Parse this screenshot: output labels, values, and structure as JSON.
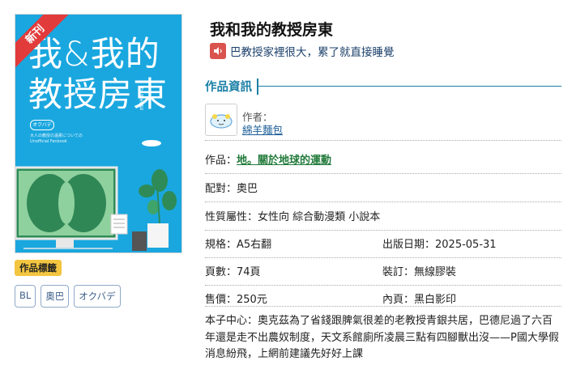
{
  "cover": {
    "badge": "新刊",
    "title_line1": "我&我的",
    "title_line2": "教授房東",
    "sub_label": "オクバデ",
    "small_text": "大人の教授の温柔についての Unofficial Fanbook",
    "author_vertical": "Eri 綿羊麵包"
  },
  "book": {
    "title": "我和我的教授房東",
    "audio_label": "巴教授家裡很大，累了就直接睡覺"
  },
  "section": {
    "title": "作品資訊"
  },
  "author": {
    "role": "作者：",
    "name": "綿羊麵包"
  },
  "rows": {
    "work_label": "作品：",
    "work_value": "地。關於地球的運動",
    "pairing": "配對：奧巴",
    "genre": "性質屬性：女性向 綜合動漫類 小說本",
    "size": "規格：A5右翻",
    "date": "出版日期：2025-05-31",
    "pages": "頁數：74頁",
    "binding": "裝訂：無線膠裝",
    "price": "售價：250元",
    "inner": "內頁：黑白影印"
  },
  "intro": "本子中心：奧克茲為了省錢跟脾氣很差的老教授青銀共居，巴德尼過了六百年還是走不出農奴制度，天文系館廁所凌晨三點有四腳獸出沒——P國大學假消息紛飛，上網前建議先好好上課",
  "tags": {
    "title": "作品標籤",
    "items": [
      "BL",
      "奧巴",
      "オクバデ"
    ]
  },
  "colors": {
    "cover_blue": "#1aa7df",
    "accent_teal": "#1a7fa6",
    "link_green": "#217a3a",
    "tag_yellow": "#f3c540",
    "badge_red": "#e23b3b"
  }
}
